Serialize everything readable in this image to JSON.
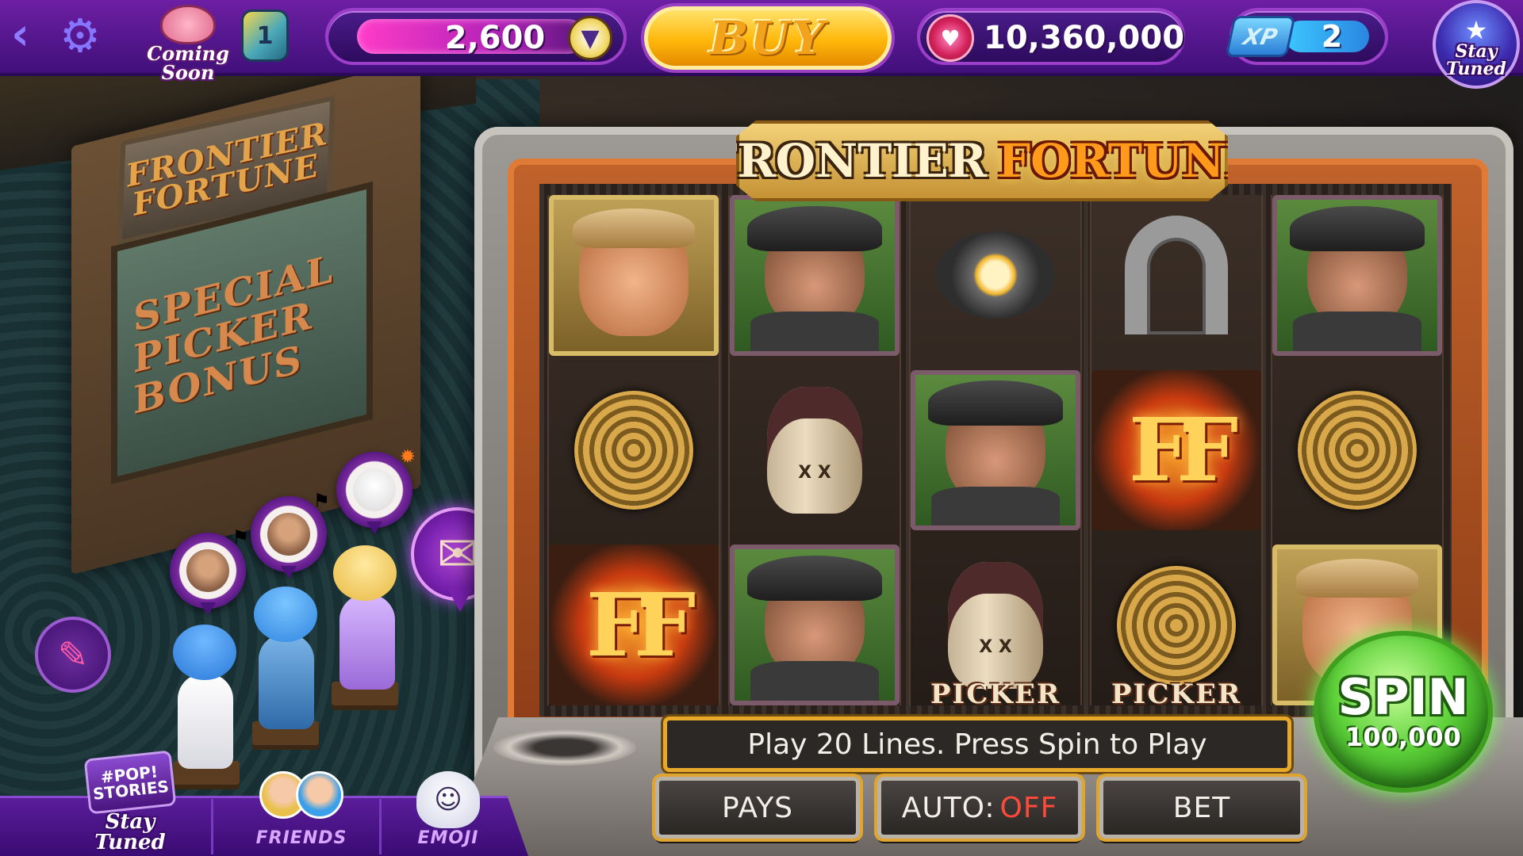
{
  "topbar": {
    "back_icon": "chevron-left-icon",
    "settings_icon": "gear-icon",
    "piggy_label": "Coming Soon",
    "level_badge": "1",
    "gems": "2,600",
    "buy_label": "BUY",
    "coins": "10,360,000",
    "xp_label": "XP",
    "xp_value": "2",
    "stay_tuned_label": "Stay Tuned"
  },
  "floor": {
    "machine_sign": "FRONTIER FORTUNE",
    "machine_screen": "SPECIAL PICKER BONUS",
    "mail_icon": "envelope-heart-icon",
    "pin_icon": "pushpin-icon"
  },
  "game": {
    "title_part1": "FRONTIER",
    "title_part2": "FORTUNE",
    "reels": [
      [
        "sheriff",
        "rope",
        "ff"
      ],
      [
        "bandit",
        "jug",
        "bandit"
      ],
      [
        "pan",
        "bandit",
        "jug-picker"
      ],
      [
        "horseshoe",
        "ff",
        "rope-picker"
      ],
      [
        "bandit",
        "rope",
        "sheriff"
      ]
    ],
    "ff_symbol": "FF",
    "picker_label": "PICKER",
    "jug_mark": "X X",
    "message": "Play 20 Lines. Press Spin to Play",
    "pays_label": "PAYS",
    "auto_label": "AUTO:",
    "auto_state": "OFF",
    "bet_label": "BET",
    "spin_label": "SPIN",
    "spin_bet": "100,000"
  },
  "bottomnav": {
    "stories_badge": "#POP! STORIES",
    "stories_label": "Stay Tuned",
    "friends_label": "FRIENDS",
    "emoji_label": "EMOJI"
  },
  "colors": {
    "topbar": "#6d1fa3",
    "buy": "#ffb70a",
    "spin": "#5ed13a",
    "auto_off": "#ff4a3a",
    "message_border": "#e8a82a"
  }
}
